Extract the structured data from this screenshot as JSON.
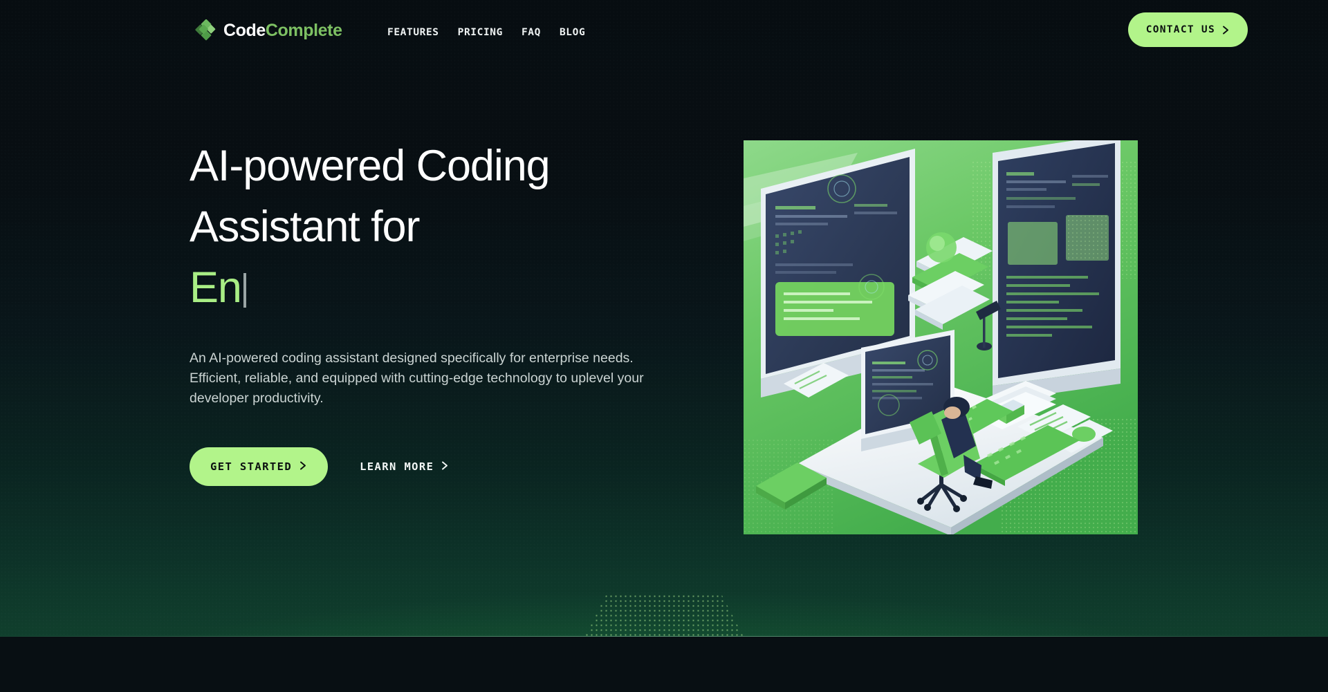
{
  "brand": {
    "name_part1": "Code",
    "name_part2": "Complete",
    "logo_icon": "diamond-cluster-logo-icon"
  },
  "nav": {
    "items": [
      {
        "label": "FEATURES"
      },
      {
        "label": "PRICING"
      },
      {
        "label": "FAQ"
      },
      {
        "label": "BLOG"
      }
    ]
  },
  "header_cta": {
    "label": "CONTACT US",
    "icon": "chevron-right-icon"
  },
  "hero": {
    "headline_line1": "AI-powered Coding",
    "headline_line2": "Assistant for",
    "headline_typed": "En",
    "subhead": "An AI-powered coding assistant designed specifically for enterprise needs. Efficient, reliable, and equipped with cutting-edge technology to uplevel your developer productivity.",
    "primary_cta": {
      "label": "GET STARTED",
      "icon": "chevron-right-icon"
    },
    "secondary_cta": {
      "label": "LEARN MORE",
      "icon": "chevron-right-icon"
    },
    "illustration": "isometric-developer-workspace-illustration"
  },
  "colors": {
    "page_background": "#070d11",
    "accent_green": "#b2f48a",
    "brand_green": "#7dc063",
    "typed_text_green": "#a9ee85",
    "headline_white": "#ffffff",
    "body_text": "#cbd4d3",
    "illustration_green": "#63c45f",
    "illustration_navy": "#2b3a55",
    "caret_gray": "#9aa5a5"
  }
}
